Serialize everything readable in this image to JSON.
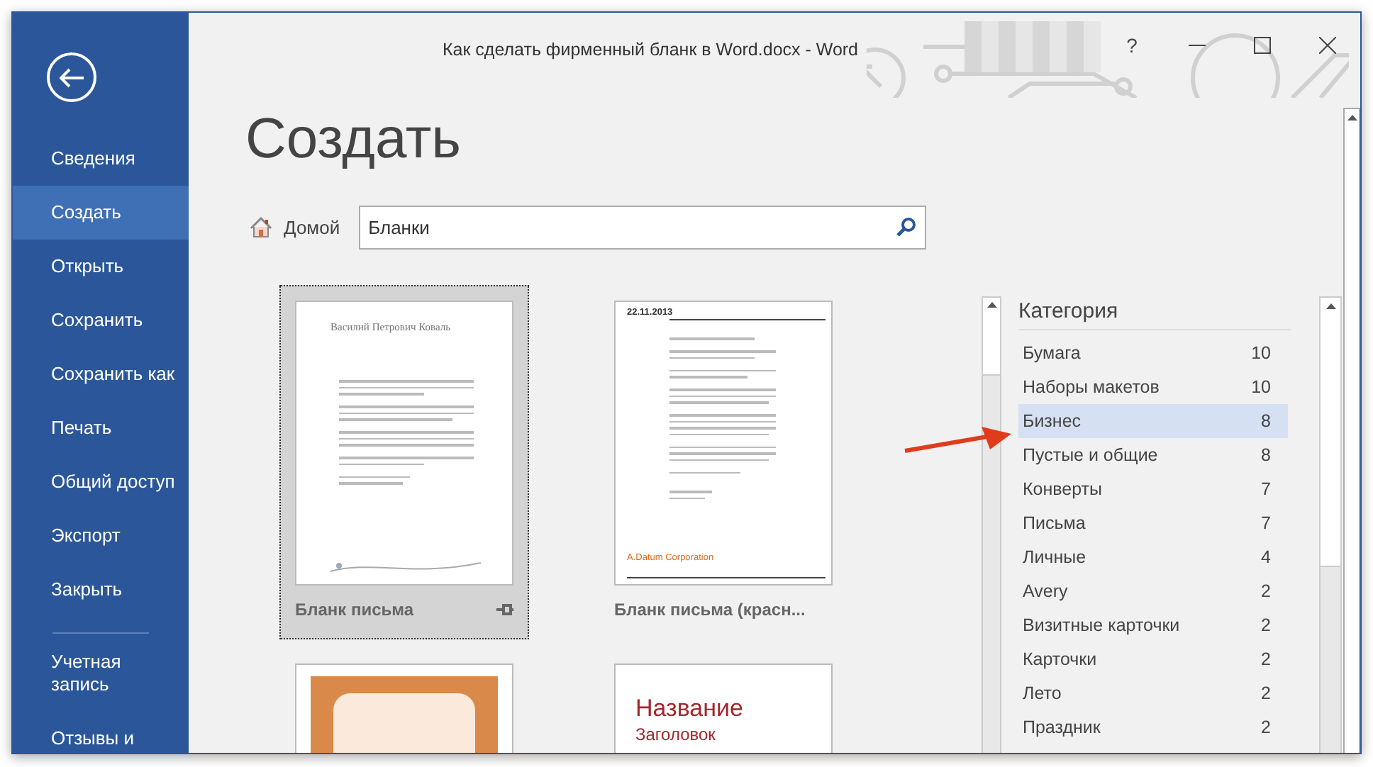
{
  "window": {
    "title": "Как сделать фирменный бланк в Word.docx  -  Word",
    "help": "?"
  },
  "sidebar": {
    "items": [
      {
        "label": "Сведения",
        "selected": false
      },
      {
        "label": "Создать",
        "selected": true
      },
      {
        "label": "Открыть",
        "selected": false
      },
      {
        "label": "Сохранить",
        "selected": false
      },
      {
        "label": "Сохранить как",
        "selected": false
      },
      {
        "label": "Печать",
        "selected": false
      },
      {
        "label": "Общий доступ",
        "selected": false
      },
      {
        "label": "Экспорт",
        "selected": false
      },
      {
        "label": "Закрыть",
        "selected": false
      }
    ],
    "bottom_items": [
      {
        "label": "Учетная запись"
      },
      {
        "label": "Отзывы и"
      }
    ]
  },
  "heading": "Создать",
  "home": {
    "label": "Домой"
  },
  "search": {
    "value": "Бланки"
  },
  "templates": [
    {
      "kind": "letter",
      "label": "Бланк письма",
      "selected": true,
      "pinned": true,
      "texts": [
        "Василий Петрович Коваль"
      ]
    },
    {
      "kind": "letterhead",
      "label": "Бланк письма (красн...",
      "selected": false,
      "texts": [
        "22.11.2013",
        "A.Datum Corporation"
      ]
    },
    {
      "kind": "card",
      "selected": false
    },
    {
      "kind": "title",
      "selected": false,
      "texts": [
        "Название",
        "Заголовок"
      ]
    }
  ],
  "categories": {
    "title": "Категория",
    "items": [
      {
        "name": "Бумага",
        "count": "10",
        "selected": false
      },
      {
        "name": "Наборы макетов",
        "count": "10",
        "selected": false
      },
      {
        "name": "Бизнес",
        "count": "8",
        "selected": true
      },
      {
        "name": "Пустые и общие",
        "count": "8",
        "selected": false
      },
      {
        "name": "Конверты",
        "count": "7",
        "selected": false
      },
      {
        "name": "Письма",
        "count": "7",
        "selected": false
      },
      {
        "name": "Личные",
        "count": "4",
        "selected": false
      },
      {
        "name": "Avery",
        "count": "2",
        "selected": false
      },
      {
        "name": "Визитные карточки",
        "count": "2",
        "selected": false
      },
      {
        "name": "Карточки",
        "count": "2",
        "selected": false
      },
      {
        "name": "Лето",
        "count": "2",
        "selected": false
      },
      {
        "name": "Праздник",
        "count": "2",
        "selected": false
      }
    ]
  }
}
